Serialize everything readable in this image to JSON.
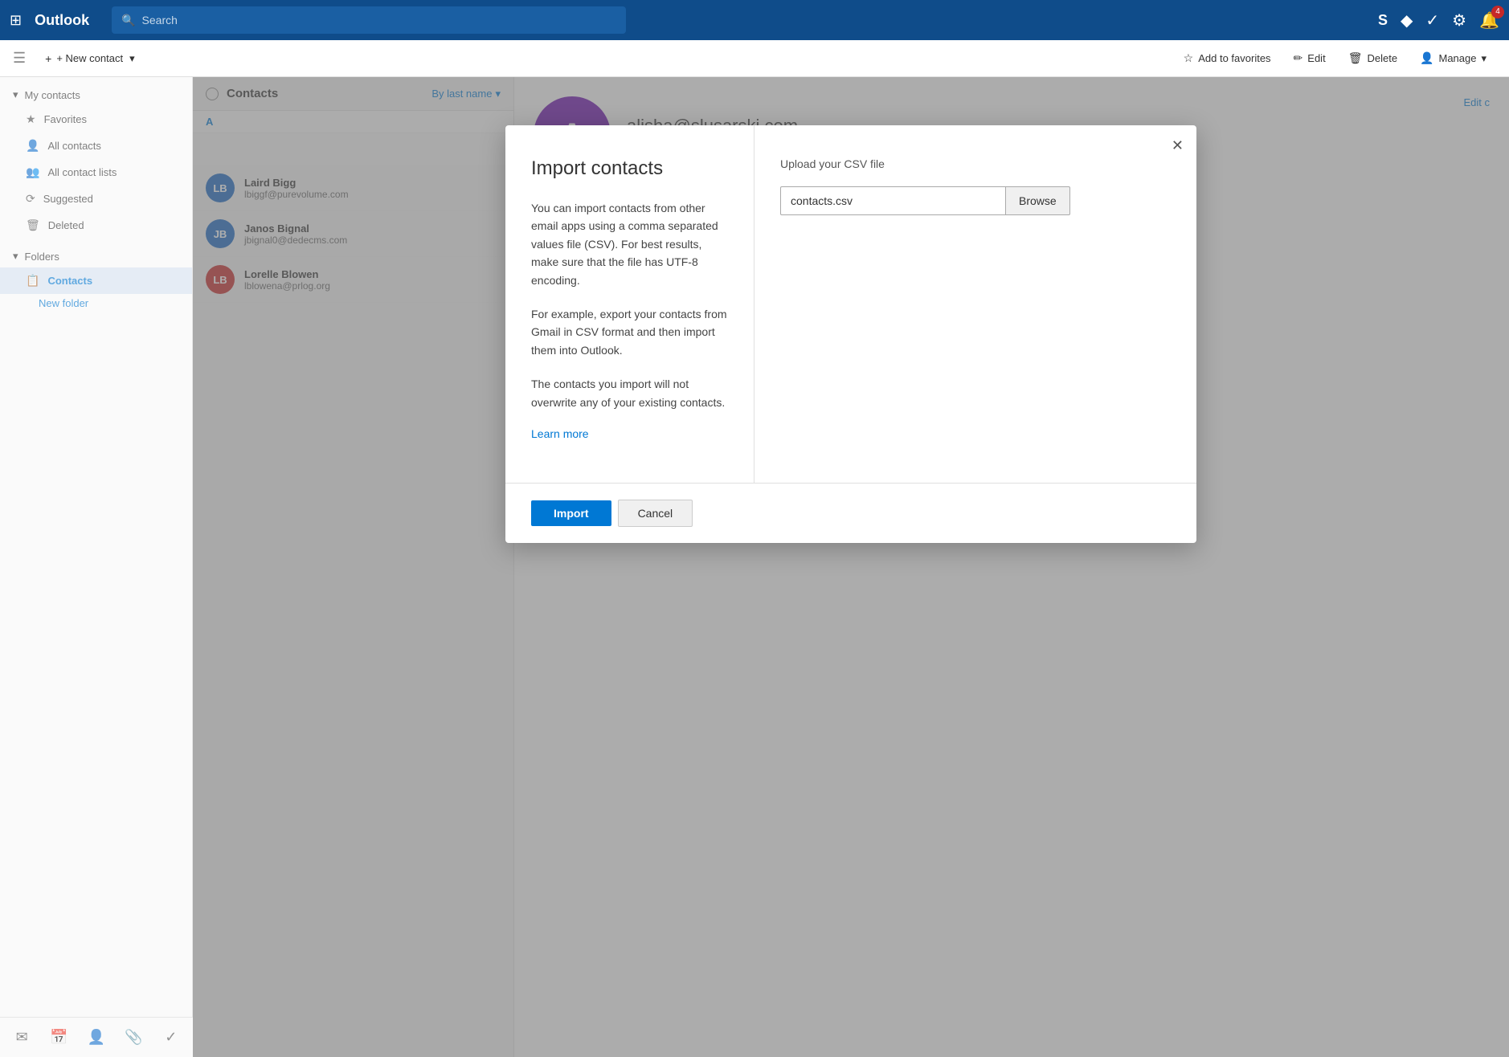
{
  "app": {
    "title": "Outlook",
    "waffle": "⊞"
  },
  "topbar": {
    "search_placeholder": "Search",
    "icons": {
      "skype": "S",
      "diamond": "◆",
      "check": "✓",
      "settings": "⚙",
      "bell": "🔔",
      "badge": "4"
    }
  },
  "subtoolbar": {
    "add_favorites": "Add to favorites",
    "edit": "Edit",
    "delete": "Delete",
    "manage": "Manage"
  },
  "sidebar": {
    "expand_label": "My contacts",
    "items": [
      {
        "label": "Favorites",
        "icon": "★"
      },
      {
        "label": "All contacts",
        "icon": "👤"
      },
      {
        "label": "All contact lists",
        "icon": "👥"
      },
      {
        "label": "Suggested",
        "icon": "⟳"
      },
      {
        "label": "Deleted",
        "icon": "🗑"
      }
    ],
    "folders_label": "Folders",
    "contacts_label": "Contacts",
    "new_folder": "New folder"
  },
  "contact_list": {
    "title": "Contacts",
    "sort_label": "By last name",
    "section_a": "A",
    "contacts": [
      {
        "initials": "LB",
        "name": "Laird Bigg",
        "email": "lbiggf@purevolume.com",
        "color": "#1565c0"
      },
      {
        "initials": "JB",
        "name": "Janos Bignal",
        "email": "jbignal0@dedecms.com",
        "color": "#1565c0"
      },
      {
        "initials": "LB",
        "name": "Lorelle Blowen",
        "email": "lblowena@prlog.org",
        "color": "#c62828"
      }
    ]
  },
  "detail": {
    "avatar_letter": "A",
    "email": "alisha@slusarski.com",
    "edit_label": "Edit c"
  },
  "new_contact_label": "+ New contact",
  "modal": {
    "title": "Import contacts",
    "desc1": "You can import contacts from other email apps using a comma separated values file (CSV). For best results, make sure that the file has UTF-8 encoding.",
    "desc2": "For example, export your contacts from Gmail in CSV format and then import them into Outlook.",
    "desc3": "The contacts you import will not overwrite any of your existing contacts.",
    "learn_more": "Learn more",
    "upload_label": "Upload your CSV file",
    "file_value": "contacts.csv",
    "browse_label": "Browse",
    "import_label": "Import",
    "cancel_label": "Cancel"
  },
  "bottom_nav": {
    "mail": "✉",
    "calendar": "📅",
    "people": "👤",
    "attachment": "📎",
    "check": "✓"
  }
}
